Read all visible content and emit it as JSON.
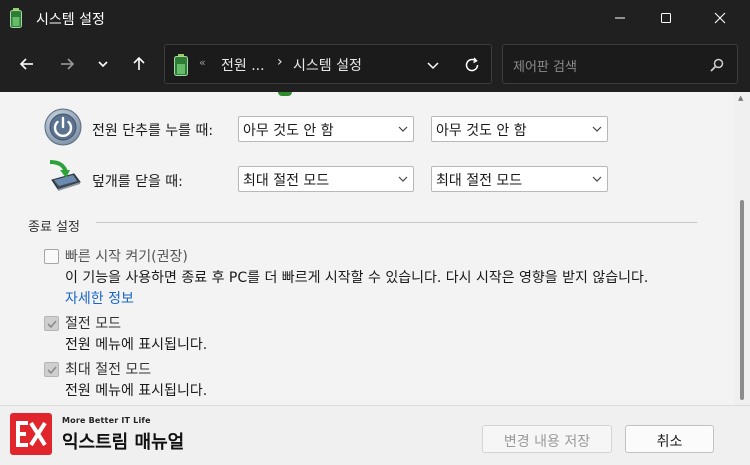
{
  "window": {
    "title": "시스템 설정"
  },
  "nav": {
    "address_crumbs": [
      "전원 ...",
      "시스템 설정"
    ],
    "address_overflow": "«",
    "address_separator": "›",
    "search_placeholder": "제어판 검색"
  },
  "buttons_rows": [
    {
      "label": "전원 단추를 누를 때:",
      "icon": "power-button-icon",
      "battery_value": "아무 것도 안 함",
      "plugged_value": "아무 것도 안 함"
    },
    {
      "label": "덮개를 닫을 때:",
      "icon": "laptop-lid-icon",
      "battery_value": "최대 절전 모드",
      "plugged_value": "최대 절전 모드"
    }
  ],
  "shutdown_settings": {
    "title": "종료 설정",
    "options": [
      {
        "label": "빠른 시작 켜기(권장)",
        "checked": false,
        "enabled": false,
        "description": "이 기능을 사용하면 종료 후 PC를 더 빠르게 시작할 수 있습니다. 다시 시작은 영향을 받지 않습니다.",
        "link": "자세한 정보"
      },
      {
        "label": "절전 모드",
        "checked": true,
        "enabled": false,
        "description": "전원 메뉴에 표시됩니다."
      },
      {
        "label": "최대 절전 모드",
        "checked": true,
        "enabled": false,
        "description": "전원 메뉴에 표시됩니다."
      }
    ]
  },
  "footer": {
    "logo_tagline": "More Better IT Life",
    "logo_name": "익스트림 매뉴얼",
    "save_label": "변경 내용 저장",
    "cancel_label": "취소"
  },
  "colors": {
    "titlebar": "#202020",
    "link": "#1866c9",
    "logo": "#e0262c"
  }
}
